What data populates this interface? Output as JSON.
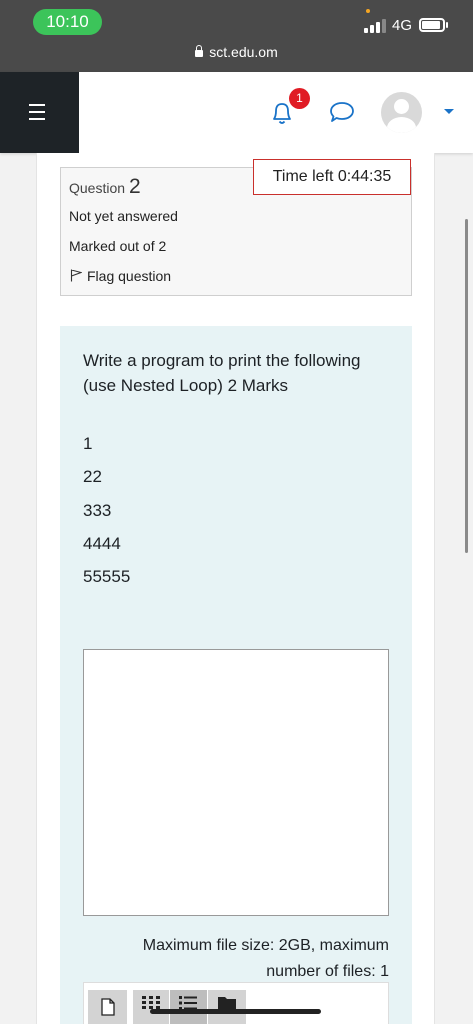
{
  "status_bar": {
    "time": "10:10",
    "network": "4G",
    "url": "sct.edu.om"
  },
  "navbar": {
    "notification_count": "1"
  },
  "question_info": {
    "question_label": "Question",
    "question_number": "2",
    "state": "Not yet answered",
    "marks": "Marked out of 2",
    "flag_label": "Flag question"
  },
  "timer": {
    "text": "Time left 0:44:35"
  },
  "question": {
    "text": "Write a program to print the following (use Nested Loop)   2 Marks",
    "lines": [
      "1",
      "22",
      "333",
      "4444",
      "55555"
    ]
  },
  "answer": {
    "value": ""
  },
  "upload": {
    "limits": "Maximum file size: 2GB, maximum number of files: 1"
  },
  "colors": {
    "accent": "#1a73c8",
    "timer_border": "#c9302c",
    "question_bg": "#e7f3f5",
    "nav_dark": "#1e2327",
    "badge": "#e01b24"
  }
}
